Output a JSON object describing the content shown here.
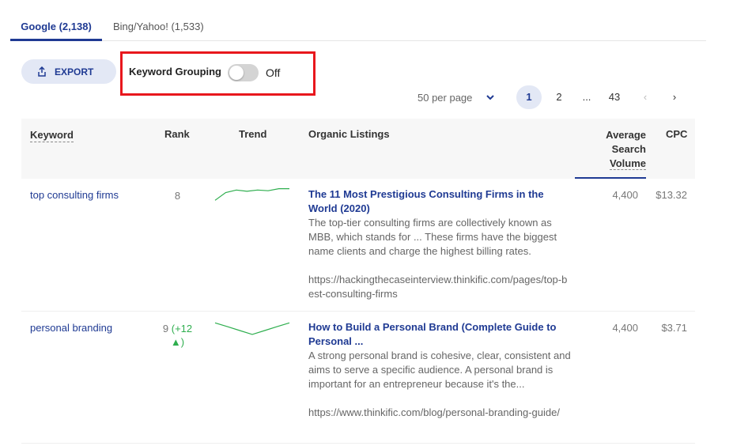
{
  "tabs": [
    {
      "label": "Google (2,138)"
    },
    {
      "label": "Bing/Yahoo! (1,533)"
    }
  ],
  "toolbar": {
    "export_label": "EXPORT",
    "grouping_label": "Keyword Grouping",
    "grouping_state": "Off"
  },
  "pagination": {
    "per_page": "50 per page",
    "pages": [
      "1",
      "2",
      "...",
      "43"
    ],
    "prev": "‹",
    "next": "›"
  },
  "table": {
    "headers": {
      "keyword": "Keyword",
      "rank": "Rank",
      "trend": "Trend",
      "organic": "Organic Listings",
      "volume_line1": "Average",
      "volume_line2": "Search",
      "volume_line3": "Volume",
      "cpc": "CPC"
    },
    "rows": [
      {
        "keyword": "top consulting firms",
        "rank": "8",
        "rank_change": "",
        "trend": [
          3,
          6,
          7,
          6.5,
          7,
          6.7,
          7.5,
          7.5
        ],
        "title": "The 11 Most Prestigious Consulting Firms in the World (2020)",
        "description": "The top-tier consulting firms are collectively known as MBB, which stands for ... These firms have the biggest name clients and charge the highest billing rates.",
        "url": "https://hackingthecaseinterview.thinkific.com/pages/top-best-consulting-firms",
        "volume": "4,400",
        "cpc": "$13.32"
      },
      {
        "keyword": "personal branding",
        "rank": "9",
        "rank_change": "(+12 ▲)",
        "trend": [
          7,
          5.5,
          4,
          2.5,
          4,
          5.5,
          7
        ],
        "title": "How to Build a Personal Brand (Complete Guide to Personal ...",
        "description": "A strong personal brand is cohesive, clear, consistent and aims to serve a specific audience. A personal brand is important for an entrepreneur because it's the...",
        "url": "https://www.thinkific.com/blog/personal-branding-guide/",
        "volume": "4,400",
        "cpc": "$3.71"
      }
    ]
  },
  "colors": {
    "accent": "#1f3a93",
    "highlight_box": "#e8171d",
    "trend_line": "#2eae4e",
    "toggle_off": "#d4d4d4"
  }
}
